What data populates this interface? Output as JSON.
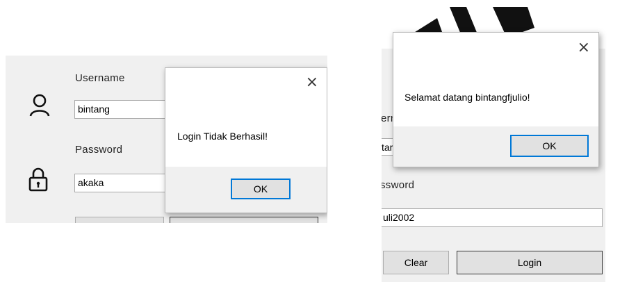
{
  "left": {
    "username_label": "Username",
    "username_value": "bintang",
    "password_label": "Password",
    "password_value": "akaka",
    "user_icon": "user-icon",
    "lock_icon": "lock-icon",
    "dialog": {
      "message": "Login Tidak Berhasil!",
      "ok_label": "OK",
      "close_glyph": "×"
    }
  },
  "right": {
    "username_label_partial": "ern",
    "username_value_partial": "tar",
    "password_label_partial": "ssword",
    "password_value": "uli2002",
    "clear_label": "Clear",
    "login_label": "Login",
    "dialog": {
      "message": "Selamat datang bintangfjulio!",
      "ok_label": "OK",
      "close_glyph": "×"
    }
  },
  "colors": {
    "window_bg": "#f0f0f0",
    "button_bg": "#e1e1e1",
    "focus_border": "#0078d7",
    "logo": "#111111"
  }
}
